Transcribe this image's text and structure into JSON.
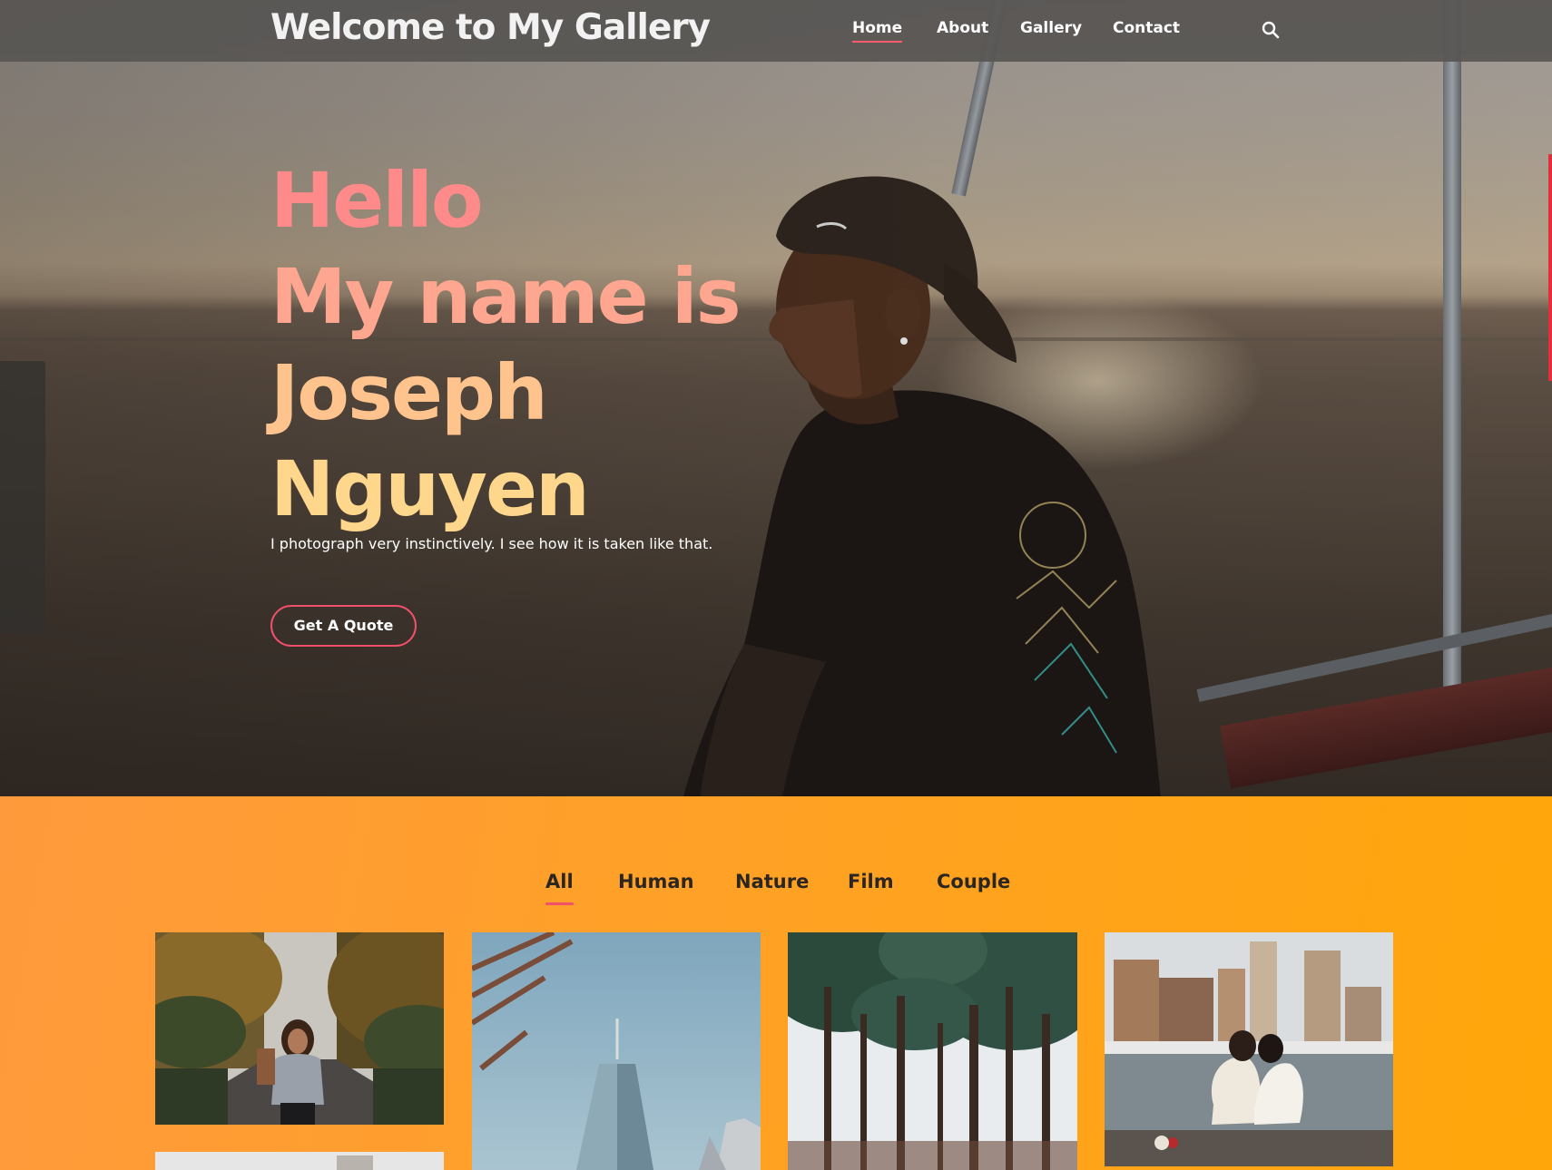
{
  "header": {
    "site_title": "Welcome to My Gallery",
    "nav": [
      "Home",
      "About",
      "Gallery",
      "Contact"
    ],
    "active_nav": "Home"
  },
  "hero": {
    "lines": [
      "Hello",
      "My name is",
      "Joseph",
      "Nguyen"
    ],
    "tagline": "I photograph very instinctively. I see how it is taken like that.",
    "cta_label": "Get A Quote"
  },
  "gallery": {
    "filters": [
      "All",
      "Human",
      "Nature",
      "Film",
      "Couple"
    ],
    "active_filter": "All"
  },
  "colors": {
    "accent": "#f0506a",
    "gallery_bg": "#ffa126",
    "header_bg": "#585654",
    "hero_hello": "#ff8a8a",
    "hero_nguyen": "#ffd78c"
  }
}
